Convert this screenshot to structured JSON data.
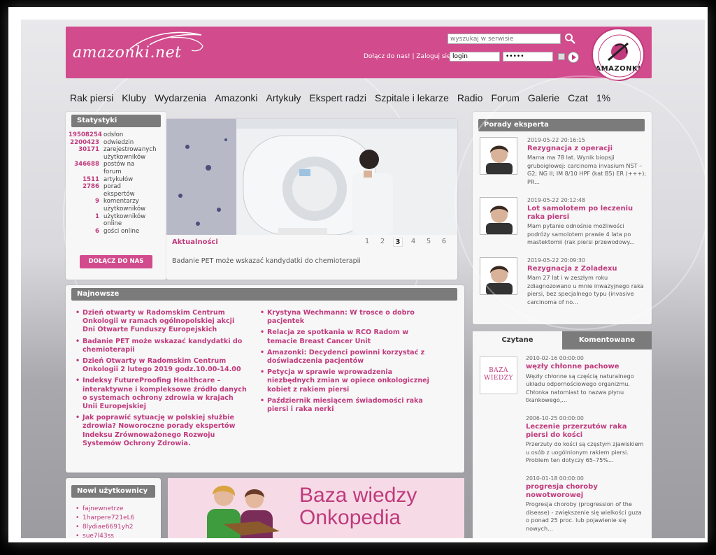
{
  "header": {
    "logo_text": "amazonki.net",
    "search_placeholder": "wyszukaj w serwisie",
    "login_label": "Dołącz do nas! | Zaloguj się:",
    "login_value": "login",
    "password_value": "•••••",
    "seal_text": "AMAZONKI",
    "colors": {
      "brand": "#d14b8d",
      "accent": "#c03a7d",
      "panel_title": "#7b7b7b"
    }
  },
  "nav": [
    "Rak piersi",
    "Kluby",
    "Wydarzenia",
    "Amazonki",
    "Artykuły",
    "Ekspert radzi",
    "Szpitale i lekarze",
    "Radio",
    "Forum",
    "Galerie",
    "Czat",
    "1%"
  ],
  "stats": {
    "title": "Statystyki",
    "rows": [
      {
        "num": "19508254",
        "label": "odsłon"
      },
      {
        "num": "2200423",
        "label": "odwiedzin"
      },
      {
        "num": "30171",
        "label": "zarejestrowanych użytkowników"
      },
      {
        "num": "346688",
        "label": "postów na forum"
      },
      {
        "num": "1511",
        "label": "artykułów"
      },
      {
        "num": "2786",
        "label": "porad ekspertów"
      },
      {
        "num": "9",
        "label": "komentarzy użytkowników"
      },
      {
        "num": "1",
        "label": "użytkowników online"
      },
      {
        "num": "6",
        "label": "gości online"
      }
    ],
    "join_label": "DOŁĄCZ DO NAS"
  },
  "slider": {
    "section_label": "Aktualności",
    "pages": [
      "1",
      "2",
      "3",
      "4",
      "5",
      "6"
    ],
    "active_page": "3",
    "caption": "Badanie PET może wskazać kandydatki do chemioterapii"
  },
  "newest": {
    "title": "Najnowsze",
    "left": [
      "Dzień otwarty w Radomskim Centrum Onkologii w ramach ogólnopolskiej akcji Dni Otwarte Funduszy Europejskich",
      "Badanie PET może wskazać kandydatki do chemioterapii",
      "Dzień Otwarty w Radomskim Centrum Onkologii 2 lutego 2019 godz.10.00-14.00",
      "Indeksy FutureProofing Healthcare – interaktywne i kompleksowe źródło danych o systemach ochrony zdrowia w krajach Unii Europejskiej",
      "Jak poprawić sytuację w polskiej służbie zdrowia? Noworoczne porady ekspertów Indeksu Zrównoważonego Rozwoju Systemów Ochrony Zdrowia."
    ],
    "right": [
      "Krystyna Wechmann: W trosce o dobro pacjentek",
      "Relacja ze spotkania w RCO Radom w temacie Breast Cancer Unit",
      "Amazonki: Decydenci powinni korzystać z doświadczenia pacjentów",
      "Petycja w sprawie wprowadzenia niezbędnych zmian w opiece onkologicznej kobiet z rakiem piersi",
      "Październik miesiącem świadomości raka piersi i raka nerki"
    ]
  },
  "expert": {
    "title": "Porady eksperta",
    "items": [
      {
        "date": "2019-05-22 20:16:15",
        "title": "Rezygnacja z operacji",
        "body": "Mama ma 78 lat. Wynik biopsji gruboigłowej: carcinoma invasium NST – G2; NG II; IM 8/10 HPF (kat B5) ER (+++); PR..."
      },
      {
        "date": "2019-05-22 20:12:48",
        "title": "Lot samolotem po leczeniu raka piersi",
        "body": "Mam pytanie odnośnie możliwości podróży samolotem prawie 4 lata po mastektomii (rak piersi przewodowy..."
      },
      {
        "date": "2019-05-22 20:09:30",
        "title": "Rezygnacja z Zoladexu",
        "body": "Mam 27 lat i w zeszłym roku zdiagnozowano u mnie inwazyjnego raka piersi, bez specjalnego typu (invasive carcinoma of no..."
      }
    ]
  },
  "tabs": {
    "active": "Czytane",
    "inactive": "Komentowane",
    "kb_line1": "BAZA",
    "kb_line2": "WIEDZY",
    "items": [
      {
        "date": "2010-02-16 00:00:00",
        "title": "węzły chłonne pachowe",
        "text": "Węzły chłonne są częścią naturalnego układu odpornościowego organizmu. Chłonka natomiast to nazwa płynu tkankowego,..."
      },
      {
        "date": "2006-10-25 00:00:00",
        "title": "Leczenie przerzutów raka piersi do kości",
        "text": "Przerzuty do kości są częstym zjawiskiem u osób z uogólnionym rakiem piersi. Problem ten dotyczy 65–75%..."
      },
      {
        "date": "2010-01-18 00:00:00",
        "title": "progresja choroby nowotworowej",
        "text": "Progresja choroby (progression of the disease) - zwiększenie się wielkości guza o ponad 25 proc. lub pojawienie się nowych..."
      }
    ]
  },
  "new_users": {
    "title": "Nowi użytkownicy",
    "items": [
      "fajnewnetrze",
      "1harpere721eL6",
      "8lydiae6691yh2",
      "sue7l43ss"
    ]
  },
  "banner": {
    "line1": "Baza wiedzy",
    "line2": "Onkopedia"
  }
}
